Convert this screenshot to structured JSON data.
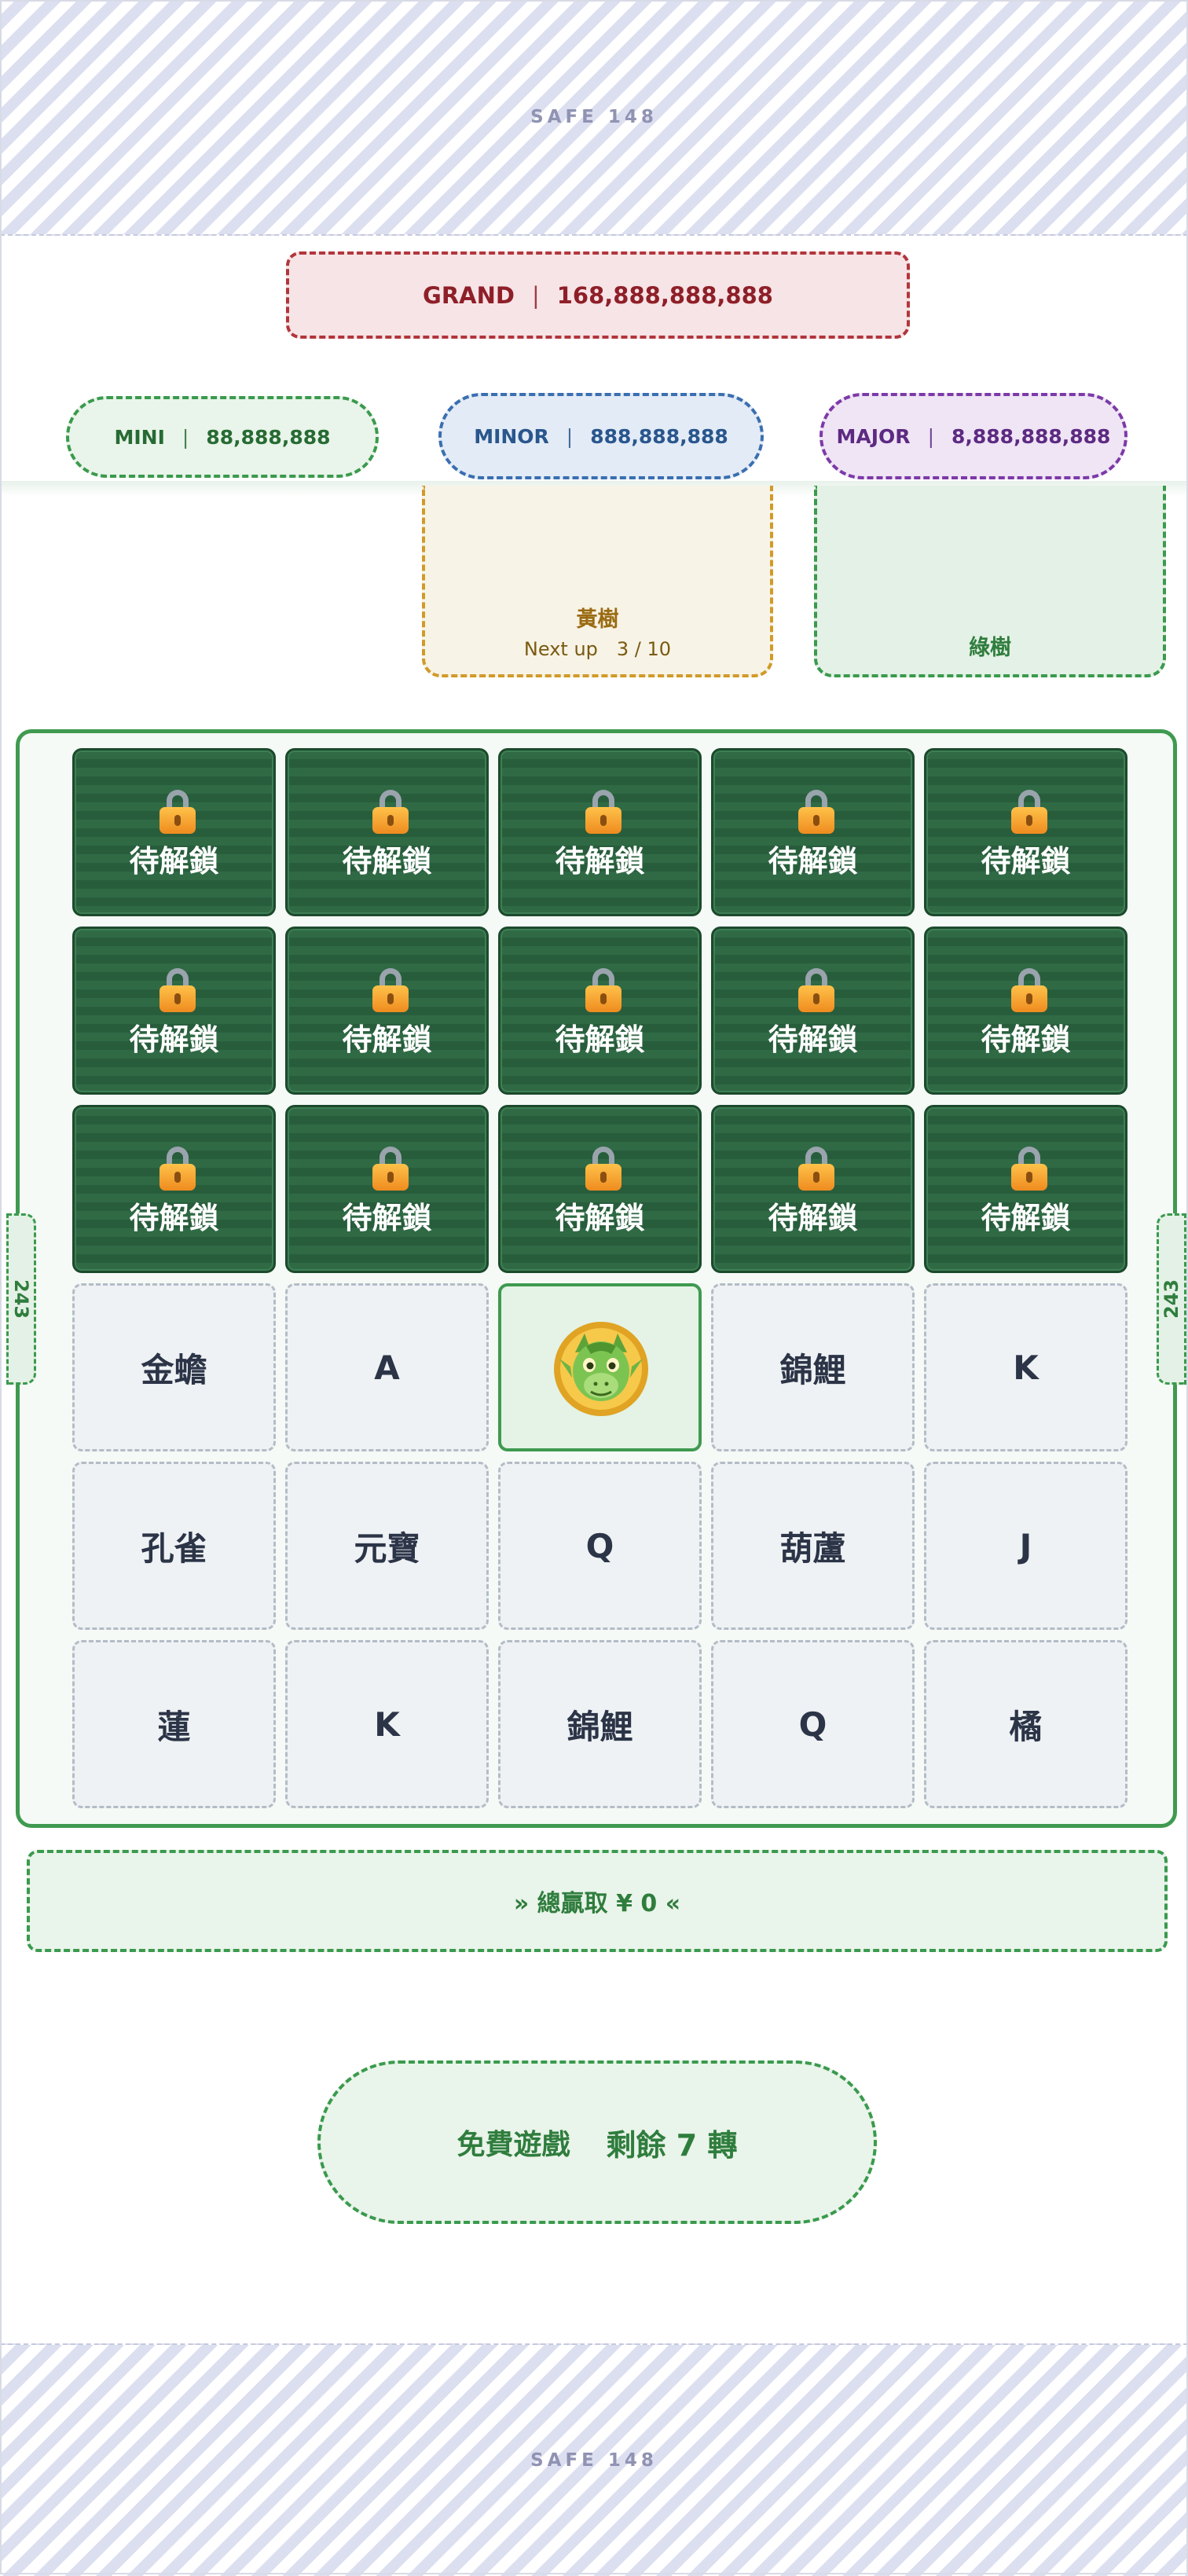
{
  "safe_zone": {
    "top_label": "SAFE 148",
    "bottom_label": "SAFE 148"
  },
  "jackpots": {
    "grand": {
      "label": "GRAND",
      "value": "168,888,888,888"
    },
    "mini": {
      "label": "MINI",
      "value": "88,888,888"
    },
    "minor": {
      "label": "MINOR",
      "value": "888,888,888"
    },
    "major": {
      "label": "MAJOR",
      "value": "8,888,888,888"
    },
    "separator": "|"
  },
  "trees": {
    "yellow": {
      "name": "黃樹",
      "progress": "Next up　3 / 10"
    },
    "green": {
      "name": "綠樹"
    }
  },
  "side_tabs": {
    "left": "243",
    "right": "243"
  },
  "grid": {
    "locked_label": "待解鎖",
    "locked_rows": 3,
    "columns": 5,
    "symbols": [
      [
        "金蟾",
        "A",
        "dragon",
        "錦鯉",
        "K"
      ],
      [
        "孔雀",
        "元寶",
        "Q",
        "葫蘆",
        "J"
      ],
      [
        "蓮",
        "K",
        "錦鯉",
        "Q",
        "橘"
      ]
    ]
  },
  "total_win": "» 總贏取 ¥ 0 «",
  "free_games": {
    "label": "免費遊戲",
    "remaining": "剩餘 7 轉"
  },
  "colors": {
    "grand": "#b0363c",
    "mini": "#3a9a4d",
    "minor": "#3a6fb0",
    "major": "#7c3aa8",
    "yellow_tree": "#d19a29",
    "board_border": "#3f9a50",
    "locked_cell": "#2f6a45"
  },
  "icons": {
    "lock": "padlock-icon",
    "dragon": "green-dragon-coin-icon"
  }
}
